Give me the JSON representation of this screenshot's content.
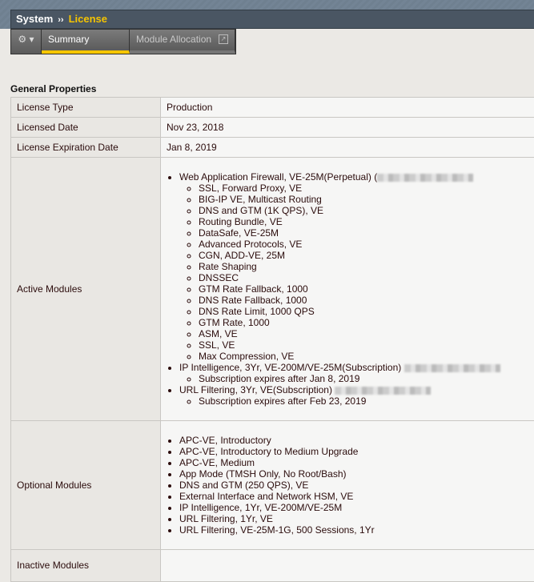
{
  "breadcrumb": {
    "section": "System",
    "separator": "››",
    "current": "License"
  },
  "tabs": [
    {
      "label": "Summary"
    },
    {
      "label": "Module Allocation"
    }
  ],
  "section_title": "General Properties",
  "rows": {
    "license_type": {
      "label": "License Type",
      "value": "Production"
    },
    "licensed_date": {
      "label": "Licensed Date",
      "value": "Nov 23, 2018"
    },
    "expiration": {
      "label": "License Expiration Date",
      "value": "Jan 8, 2019"
    },
    "active": {
      "label": "Active Modules",
      "m0": "Web Application Firewall, VE-25M(Perpetual) (",
      "m0_sub": [
        "SSL, Forward Proxy, VE",
        "BIG-IP VE, Multicast Routing",
        "DNS and GTM (1K QPS), VE",
        "Routing Bundle, VE",
        "DataSafe, VE-25M",
        "Advanced Protocols, VE",
        "CGN, ADD-VE, 25M",
        "Rate Shaping",
        "DNSSEC",
        "GTM Rate Fallback, 1000",
        "DNS Rate Fallback, 1000",
        "DNS Rate Limit, 1000 QPS",
        "GTM Rate, 1000",
        "ASM, VE",
        "SSL, VE",
        "Max Compression, VE"
      ],
      "m1": "IP Intelligence, 3Yr, VE-200M/VE-25M(Subscription)",
      "m1_sub": "Subscription expires after Jan 8, 2019",
      "m2": "URL Filtering, 3Yr, VE(Subscription)",
      "m2_sub": "Subscription expires after Feb 23, 2019"
    },
    "optional": {
      "label": "Optional Modules",
      "items": [
        "APC-VE, Introductory",
        "APC-VE, Introductory to Medium Upgrade",
        "APC-VE, Medium",
        "App Mode (TMSH Only, No Root/Bash)",
        "DNS and GTM (250 QPS), VE",
        "External Interface and Network HSM, VE",
        "IP Intelligence, 1Yr, VE-200M/VE-25M",
        "URL Filtering, 1Yr, VE",
        "URL Filtering, VE-25M-1G, 500 Sessions, 1Yr"
      ]
    },
    "inactive": {
      "label": "Inactive Modules"
    }
  }
}
